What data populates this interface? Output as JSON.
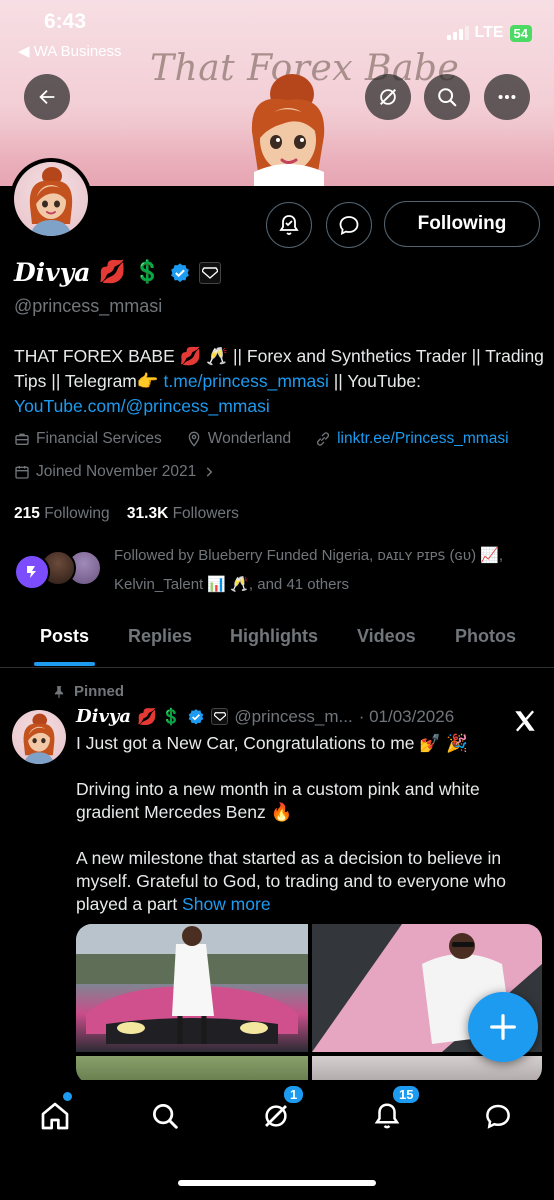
{
  "status_bar": {
    "time": "6:43",
    "back_app": "◀ WA Business",
    "network": "LTE",
    "battery": "54"
  },
  "banner": {
    "title": "That Forex Babe"
  },
  "profile": {
    "name": "Divya",
    "name_emojis": "💋 💲",
    "handle": "@princess_mmasi",
    "following_button": "Following",
    "bio": {
      "part1": "THAT FOREX BABE 💋 🥂  || Forex and Synthetics Trader || Trading Tips || Telegram👉 ",
      "telegram_link": "t.me/princess_mmasi",
      "part2": " || YouTube: ",
      "youtube_link": "YouTube.com/@princess_mmasi"
    },
    "category": "Financial Services",
    "location": "Wonderland",
    "website": "linktr.ee/Princess_mmasi",
    "joined": "Joined November 2021",
    "following_count": "215",
    "following_label": "Following",
    "followers_count": "31.3K",
    "followers_label": "Followers",
    "followed_by": "Followed by Blueberry Funded Nigeria, ᴅᴀɪʟʏ ᴘɪᴘꜱ (ɢᴜ) 📈, Kelvin_Talent 📊 🥂, and 41 others"
  },
  "tabs": [
    {
      "label": "Posts",
      "active": true
    },
    {
      "label": "Replies",
      "active": false
    },
    {
      "label": "Highlights",
      "active": false
    },
    {
      "label": "Videos",
      "active": false
    },
    {
      "label": "Photos",
      "active": false
    }
  ],
  "post": {
    "pinned_label": "Pinned",
    "name": "Divya",
    "name_emojis": "💋 💲",
    "handle": "@princess_m...",
    "date": "· 01/03/2026",
    "line1": "I Just got a New Car, Congratulations to me 💅 🎉",
    "para2": "Driving into a new month in a custom pink and white gradient Mercedes Benz 🔥",
    "para3": "A new milestone that started as a decision to believe in myself. Grateful to God, to trading and to everyone who played a part ",
    "show_more": "Show more"
  },
  "bottom_nav": {
    "notifications_badge": "1",
    "messages_badge": "15"
  },
  "colors": {
    "accent": "#1d9bf0",
    "background": "#000000",
    "muted_text": "#71767b",
    "border": "#536471"
  }
}
